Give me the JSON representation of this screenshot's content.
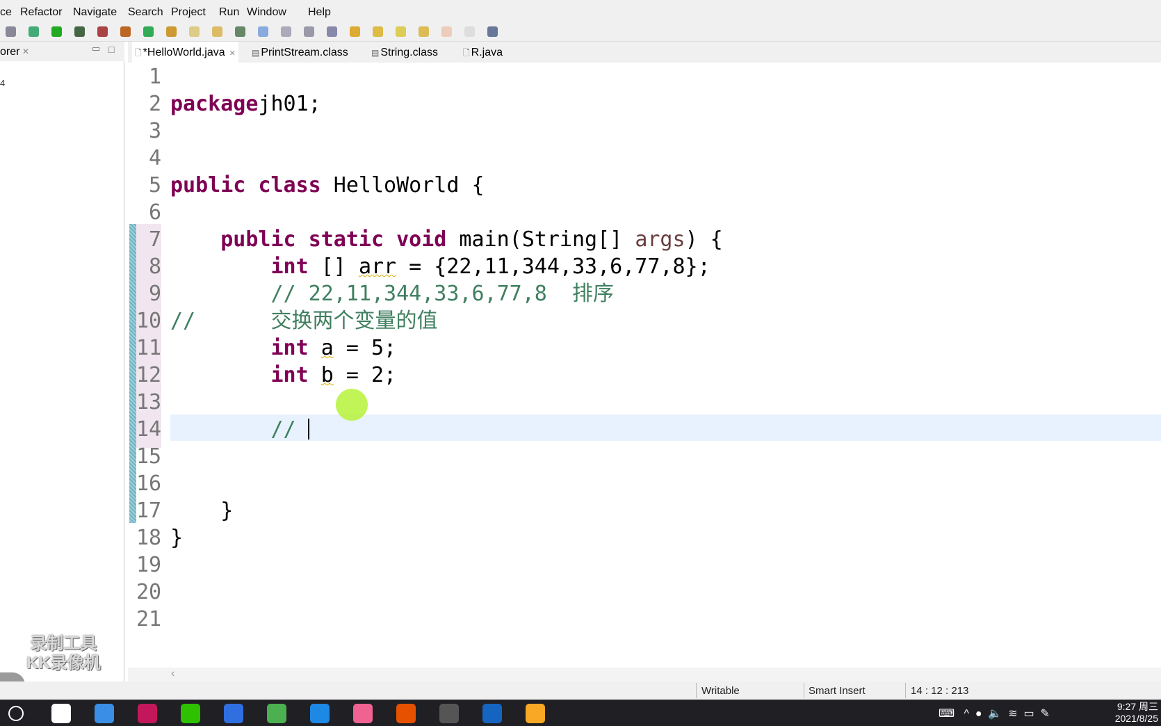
{
  "menu": [
    "ce",
    "Refactor",
    "Navigate",
    "Search",
    "Project",
    "Run",
    "Window",
    "Help"
  ],
  "left_panel": {
    "tab_label": "orer",
    "close": "✕",
    "minimize": "▭",
    "maximize": "□",
    "tree_fragment": "4"
  },
  "tabs": [
    {
      "label": "*HelloWorld.java",
      "close": "✕",
      "icon": "java-file-icon",
      "active": true
    },
    {
      "label": "PrintStream.class",
      "icon": "class-file-icon"
    },
    {
      "label": "String.class",
      "icon": "class-file-icon"
    },
    {
      "label": "R.java",
      "icon": "java-file-icon"
    }
  ],
  "code_lines": [
    {
      "n": "1",
      "t": []
    },
    {
      "n": "2",
      "t": [
        [
          "kw",
          "package"
        ],
        [
          "",
          "jh01;"
        ]
      ]
    },
    {
      "n": "3",
      "t": []
    },
    {
      "n": "4",
      "t": []
    },
    {
      "n": "5",
      "t": [
        [
          "kw",
          "public"
        ],
        [
          "",
          " "
        ],
        [
          "kw",
          "class"
        ],
        [
          "",
          " HelloWorld {"
        ]
      ]
    },
    {
      "n": "6",
      "t": []
    },
    {
      "n": "7",
      "t": [
        [
          "",
          "    "
        ],
        [
          "kw",
          "public"
        ],
        [
          "",
          " "
        ],
        [
          "kw",
          "static"
        ],
        [
          "",
          " "
        ],
        [
          "kw",
          "void"
        ],
        [
          "",
          " main(String[] "
        ],
        [
          "var",
          "args"
        ],
        [
          "",
          ") {"
        ]
      ]
    },
    {
      "n": "8",
      "t": [
        [
          "",
          "        "
        ],
        [
          "kw",
          "int"
        ],
        [
          "",
          " [] "
        ],
        [
          "sq",
          "arr"
        ],
        [
          "",
          " = {22,11,344,33,6,77,8};"
        ]
      ]
    },
    {
      "n": "9",
      "t": [
        [
          "",
          "        "
        ],
        [
          "cm",
          "// 22,11,344,33,6,77,8  排序"
        ]
      ]
    },
    {
      "n": "10",
      "t": [
        [
          "cm",
          "//      交换两个变量的值"
        ]
      ]
    },
    {
      "n": "11",
      "t": [
        [
          "",
          "        "
        ],
        [
          "kw",
          "int"
        ],
        [
          "",
          " "
        ],
        [
          "sq",
          "a"
        ],
        [
          "",
          " = 5;"
        ]
      ]
    },
    {
      "n": "12",
      "t": [
        [
          "",
          "        "
        ],
        [
          "kw",
          "int"
        ],
        [
          "",
          " "
        ],
        [
          "sq",
          "b"
        ],
        [
          "",
          " = 2;"
        ]
      ]
    },
    {
      "n": "13",
      "t": []
    },
    {
      "n": "14",
      "t": [
        [
          "",
          "        "
        ],
        [
          "cm",
          "// "
        ]
      ]
    },
    {
      "n": "15",
      "t": []
    },
    {
      "n": "16",
      "t": []
    },
    {
      "n": "17",
      "t": [
        [
          "",
          "    }"
        ]
      ]
    },
    {
      "n": "18",
      "t": [
        [
          "",
          "}"
        ]
      ]
    },
    {
      "n": "19",
      "t": []
    },
    {
      "n": "20",
      "t": []
    },
    {
      "n": "21",
      "t": []
    }
  ],
  "status": {
    "writable": "Writable",
    "insert_mode": "Smart Insert",
    "position": "14 : 12 : 213"
  },
  "watermark": [
    "录制工具",
    "KK录像机"
  ],
  "clock": {
    "time": "9:27 周三",
    "date": "2021/8/25"
  },
  "taskbar_icons": [
    {
      "name": "search-circle-icon",
      "color": "#1f1f24"
    },
    {
      "name": "app-s-icon",
      "color": "#ffffff"
    },
    {
      "name": "contacts-icon",
      "color": "#3a8ee6"
    },
    {
      "name": "intellij-icon",
      "color": "#c2185b"
    },
    {
      "name": "wechat-icon",
      "color": "#2dc100"
    },
    {
      "name": "wps-icon",
      "color": "#2f6fe0"
    },
    {
      "name": "browser-icon",
      "color": "#4caf50"
    },
    {
      "name": "photos-icon",
      "color": "#1e88e5"
    },
    {
      "name": "app-pink-icon",
      "color": "#f06292"
    },
    {
      "name": "game-icon",
      "color": "#e65100"
    },
    {
      "name": "eclipse-icon",
      "color": "#555555"
    },
    {
      "name": "work-icon",
      "color": "#1565c0"
    },
    {
      "name": "folder-icon",
      "color": "#f9a825"
    }
  ]
}
